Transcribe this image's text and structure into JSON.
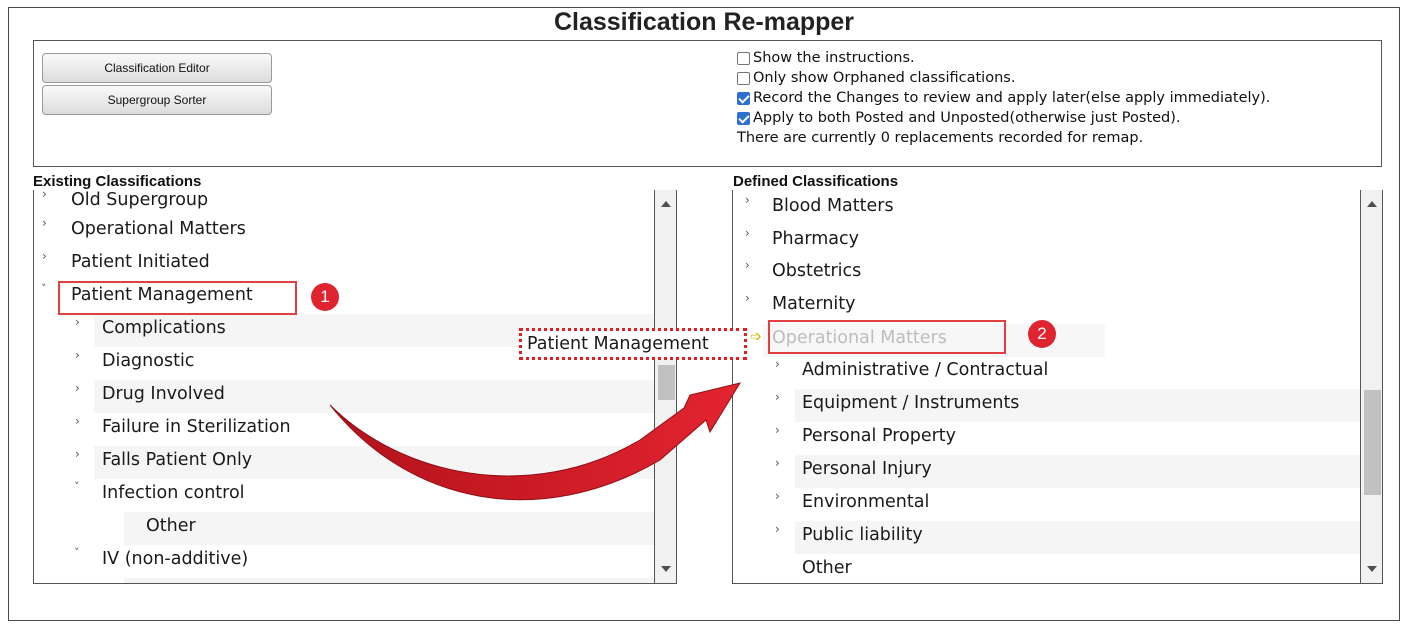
{
  "title": "Classification Re-mapper",
  "buttons": {
    "classification_editor": "Classification Editor",
    "supergroup_sorter": "Supergroup Sorter"
  },
  "options": {
    "show_instructions": {
      "label": "Show the instructions.",
      "checked": false
    },
    "orphaned_only": {
      "label": "Only show Orphaned classifications.",
      "checked": false
    },
    "record_changes": {
      "label": "Record the Changes to review and apply later(else apply immediately).",
      "checked": true
    },
    "apply_both": {
      "label": "Apply to both Posted and Unposted(otherwise just Posted).",
      "checked": true
    }
  },
  "status": "There are currently 0 replacements recorded for remap.",
  "existing": {
    "label": "Existing Classifications",
    "items": [
      "Old Supergroup",
      "Operational Matters",
      "Patient Initiated",
      "Patient Management",
      "Complications",
      "Diagnostic",
      "Drug Involved",
      "Failure in Sterilization",
      "Falls Patient Only",
      "Infection control",
      "Other",
      "IV (non-additive)"
    ]
  },
  "defined": {
    "label": "Defined Classifications",
    "items": [
      "Blood Matters",
      "Pharmacy",
      "Obstetrics",
      "Maternity",
      "Operational Matters",
      "Administrative / Contractual",
      "Equipment / Instruments",
      "Personal Property",
      "Personal Injury",
      "Environmental",
      "Public liability",
      "Other"
    ]
  },
  "drag": {
    "text": "Patient Management"
  },
  "badges": {
    "one": "1",
    "two": "2"
  },
  "colors": {
    "annotation": "#e0242f",
    "checkbox": "#2f6fd1"
  }
}
